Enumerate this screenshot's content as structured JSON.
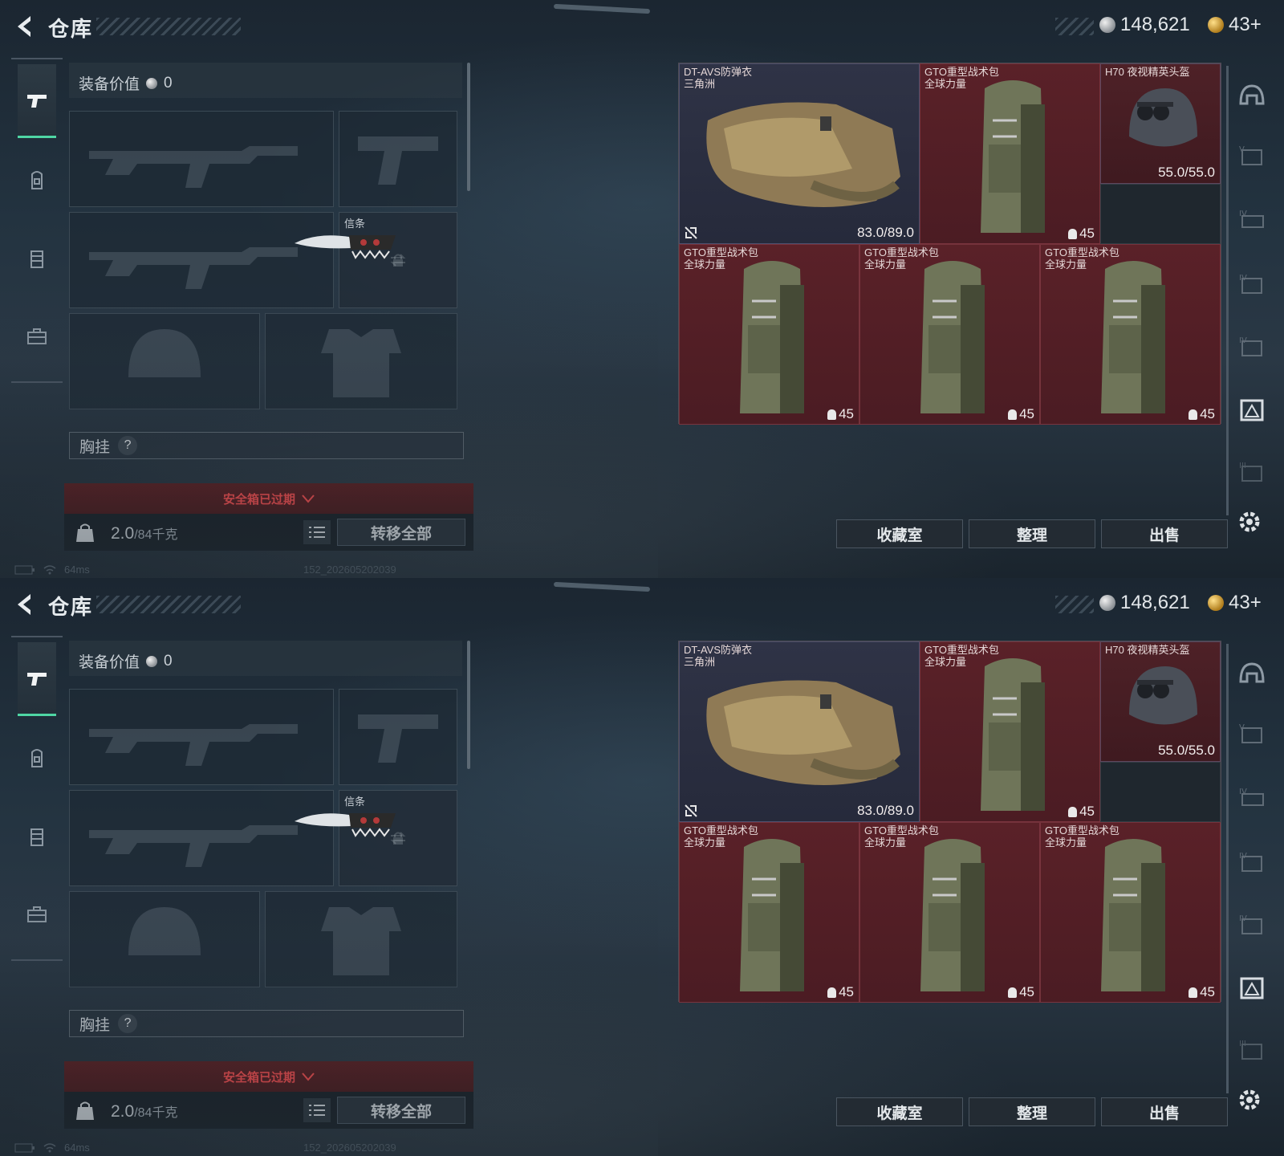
{
  "screens": [
    {
      "header": {
        "title": "仓库",
        "silver": "148,621",
        "gold": "43+"
      },
      "equipment": {
        "value_label": "装备价值",
        "value": "0",
        "melee_caption": "信条",
        "chest_label": "胸挂",
        "chest_help": "?",
        "expired_text": "安全箱已过期",
        "weight_value": "2.0",
        "weight_unit": "/84千克",
        "transfer_all": "转移全部"
      },
      "items": [
        {
          "name": "DT-AVS防弹衣",
          "sub": "三角洲",
          "durability": "83.0/89.0"
        },
        {
          "name": "GTO重型战术包",
          "sub": "全球力量",
          "capacity": "45"
        },
        {
          "name": "H70 夜视精英头盔",
          "durability": "55.0/55.0"
        },
        {
          "name": "GTO重型战术包",
          "sub": "全球力量",
          "capacity": "45"
        },
        {
          "name": "GTO重型战术包",
          "sub": "全球力量",
          "capacity": "45"
        },
        {
          "name": "GTO重型战术包",
          "sub": "全球力量",
          "capacity": "45"
        }
      ],
      "actions": {
        "collection": "收藏室",
        "sort": "整理",
        "sell": "出售"
      },
      "status": {
        "ping": "64ms",
        "build": "152_202605202039"
      }
    },
    {
      "header": {
        "title": "仓库",
        "silver": "148,621",
        "gold": "43+"
      },
      "equipment": {
        "value_label": "装备价值",
        "value": "0",
        "melee_caption": "信条",
        "chest_label": "胸挂",
        "chest_help": "?",
        "expired_text": "安全箱已过期",
        "weight_value": "2.0",
        "weight_unit": "/84千克",
        "transfer_all": "转移全部"
      },
      "items": [
        {
          "name": "DT-AVS防弹衣",
          "sub": "三角洲",
          "durability": "83.0/89.0"
        },
        {
          "name": "GTO重型战术包",
          "sub": "全球力量",
          "capacity": "45"
        },
        {
          "name": "H70 夜视精英头盔",
          "durability": "55.0/55.0"
        },
        {
          "name": "GTO重型战术包",
          "sub": "全球力量",
          "capacity": "45"
        },
        {
          "name": "GTO重型战术包",
          "sub": "全球力量",
          "capacity": "45"
        },
        {
          "name": "GTO重型战术包",
          "sub": "全球力量",
          "capacity": "45"
        }
      ],
      "actions": {
        "collection": "收藏室",
        "sort": "整理",
        "sell": "出售"
      },
      "status": {
        "ping": "64ms",
        "build": "152_202605202039"
      }
    }
  ],
  "colors": {
    "accent_green": "#4fd6a4",
    "warning_red": "#ff4a4a",
    "item_red": "#5a2128",
    "item_blue": "#2f3346"
  },
  "icons": [
    "back-arrow-icon",
    "silver-coin-icon",
    "gold-coin-icon",
    "pistol-icon",
    "backpack-icon",
    "vest-icon",
    "case-icon",
    "lock-icon",
    "swap-icon",
    "list-icon",
    "help-icon",
    "helmet-filter-icon",
    "armor-filter-icon",
    "gear-icon",
    "capacity-icon",
    "broken-icon"
  ]
}
